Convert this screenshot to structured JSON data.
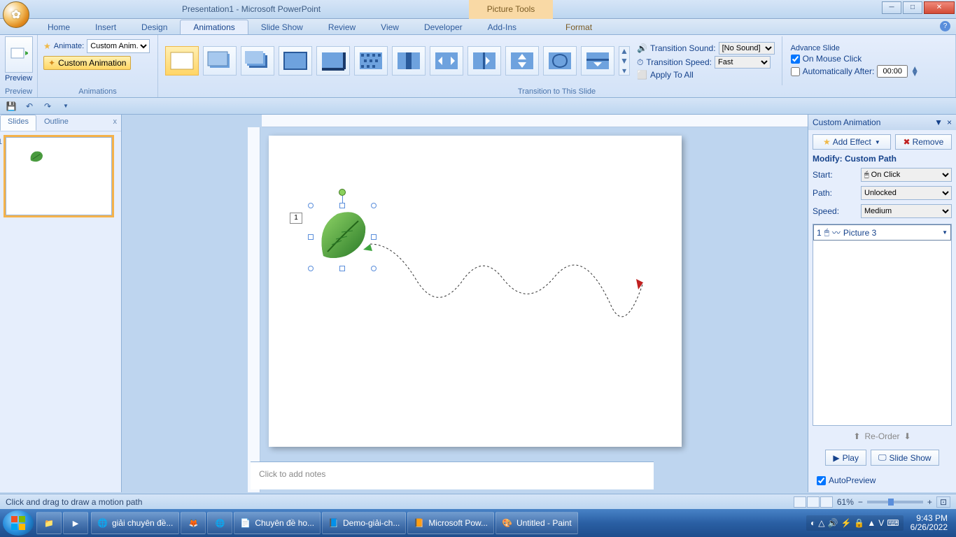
{
  "titlebar": {
    "title": "Presentation1 - Microsoft PowerPoint",
    "contextual": "Picture Tools"
  },
  "tabs": {
    "home": "Home",
    "insert": "Insert",
    "design": "Design",
    "animations": "Animations",
    "slideshow": "Slide Show",
    "review": "Review",
    "view": "View",
    "developer": "Developer",
    "addins": "Add-Ins",
    "format": "Format"
  },
  "ribbon": {
    "preview_label": "Preview",
    "preview_group": "Preview",
    "animate_label": "Animate:",
    "animate_value": "Custom Anim...",
    "custom_btn": "Custom Animation",
    "anim_group": "Animations",
    "trans_group": "Transition to This Slide",
    "sound_label": "Transition Sound:",
    "sound_value": "[No Sound]",
    "speed_label": "Transition Speed:",
    "speed_value": "Fast",
    "apply_all": "Apply To All",
    "advance_title": "Advance Slide",
    "on_click": "On Mouse Click",
    "auto_after": "Automatically After:",
    "auto_time": "00:00"
  },
  "slides_panel": {
    "slides_tab": "Slides",
    "outline_tab": "Outline",
    "num": "1"
  },
  "notes": {
    "placeholder": "Click to add notes"
  },
  "anim_pane": {
    "title": "Custom Animation",
    "add_effect": "Add Effect",
    "remove": "Remove",
    "modify": "Modify: Custom Path",
    "start_label": "Start:",
    "start_value": "On Click",
    "path_label": "Path:",
    "path_value": "Unlocked",
    "speed_label": "Speed:",
    "speed_value": "Medium",
    "item_num": "1",
    "item_name": "Picture 3",
    "reorder": "Re-Order",
    "play": "Play",
    "slideshow": "Slide Show",
    "autopreview": "AutoPreview"
  },
  "slide": {
    "anim_tag": "1"
  },
  "status": {
    "hint": "Click and drag to draw a motion path",
    "zoom": "61%"
  },
  "taskbar": {
    "items": [
      {
        "label": "giải chuyên đề..."
      },
      {
        "label": "Chuyên đề ho..."
      },
      {
        "label": "Demo-giải-ch..."
      },
      {
        "label": "Microsoft Pow..."
      },
      {
        "label": "Untitled - Paint"
      }
    ],
    "time": "9:43 PM",
    "date": "6/26/2022"
  }
}
